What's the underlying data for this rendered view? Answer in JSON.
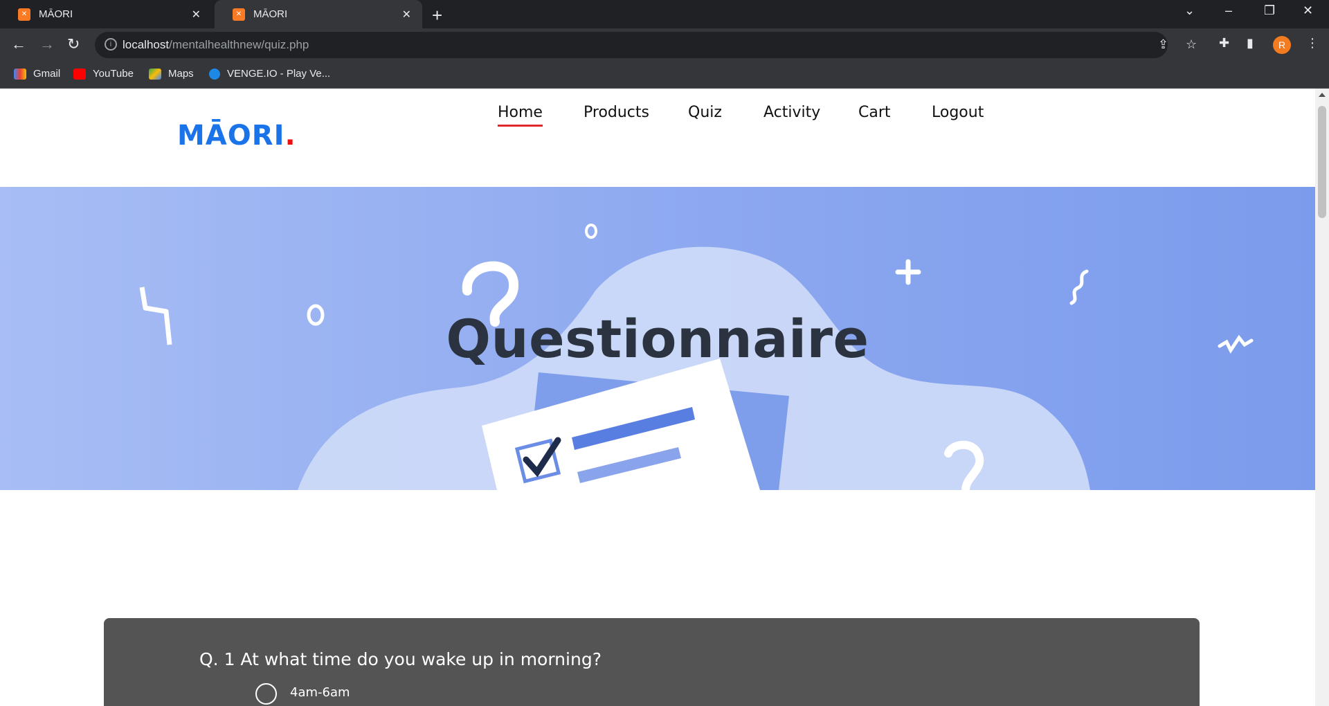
{
  "browser": {
    "tabs": [
      {
        "title": "MĀORI",
        "active": false
      },
      {
        "title": "MĀORI",
        "active": true
      }
    ],
    "url_host": "localhost",
    "url_path": "/mentalhealthnew/quiz.php",
    "bookmarks": [
      {
        "label": "Gmail",
        "icon": "gmail-icon"
      },
      {
        "label": "YouTube",
        "icon": "youtube-icon"
      },
      {
        "label": "Maps",
        "icon": "maps-icon"
      },
      {
        "label": "VENGE.IO - Play Ve...",
        "icon": "venge-icon"
      }
    ],
    "profile_initial": "R"
  },
  "site": {
    "logo_text": "MĀORI",
    "logo_dot": ".",
    "nav": [
      {
        "label": "Home",
        "active": true
      },
      {
        "label": "Products",
        "active": false
      },
      {
        "label": "Quiz",
        "active": false
      },
      {
        "label": "Activity",
        "active": false
      },
      {
        "label": "Cart",
        "active": false
      },
      {
        "label": "Logout",
        "active": false
      }
    ]
  },
  "hero": {
    "title": "Questionnaire"
  },
  "quiz": {
    "questions": [
      {
        "text": "Q. 1 At what time do you wake up in morning?",
        "options": [
          "4am-6am"
        ],
        "selected": null
      }
    ]
  },
  "colors": {
    "logo": "#1a73e8",
    "logo_dot": "#e81010",
    "nav_active_underline": "#e0282e",
    "hero_bg": "#8aa6ef",
    "hero_title": "#2c3340",
    "card_bg": "#545454",
    "tab_favicon": "#fb7a24"
  }
}
